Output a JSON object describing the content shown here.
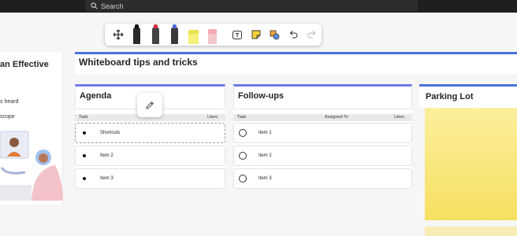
{
  "search": {
    "placeholder": "Search"
  },
  "toolbar": {
    "tools": [
      "move-tool",
      "black-pen",
      "red-pen",
      "blue-pen",
      "yellow-highlighter",
      "eraser",
      "text-box",
      "sticky-note",
      "shapes",
      "undo",
      "redo"
    ]
  },
  "left_panel": {
    "title": "an Effective",
    "line1": "s heard",
    "line2": "scope"
  },
  "board": {
    "title": "Whiteboard tips and tricks"
  },
  "agenda": {
    "heading": "Agenda",
    "col_task": "Task",
    "col_likes": "Likes",
    "rows": [
      "Shortcuts",
      "Item 2",
      "Item 3"
    ]
  },
  "followups": {
    "heading": "Follow-ups",
    "col_task": "Task",
    "col_assigned": "Assigned To",
    "col_likes": "Likes",
    "rows": [
      "Item 1",
      "Item 2",
      "Item 3"
    ]
  },
  "parking": {
    "heading": "Parking Lot"
  },
  "colors": {
    "accent": "#4a73d9",
    "sticky": "#f7df60"
  }
}
